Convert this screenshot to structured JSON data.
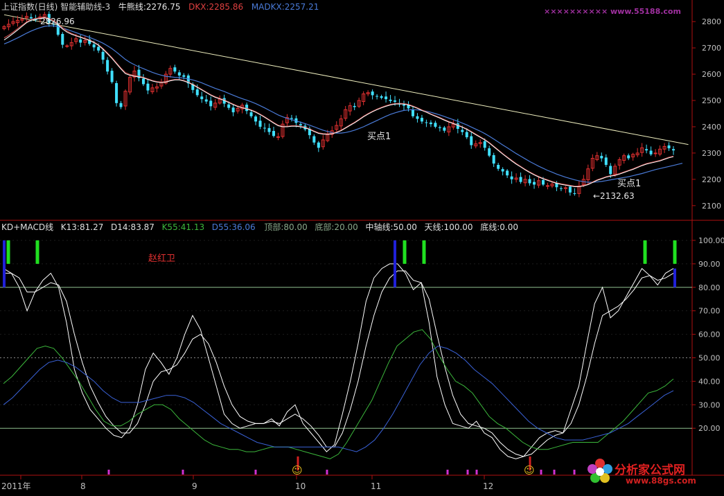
{
  "colors": {
    "bg": "#000000",
    "frame": "#b01010",
    "up": "#e03030",
    "down": "#40e0ff",
    "ma_white": "#ffffff",
    "ma_red": "#c04848",
    "ma_blue": "#4a7bd8",
    "trend": "#f0f0c0",
    "k_line": "#ffffff",
    "d_line": "#ffffff",
    "k55": "#3cb83c",
    "d55": "#3a62d8",
    "bar_green": "#20e020",
    "bar_blue": "#2020d8",
    "bar_magenta": "#d030d0",
    "grid": "#2a2a2a",
    "ref_line": "#90c090"
  },
  "header_top": {
    "title": "上证指数(日线)",
    "indicator": "智能辅助线-3",
    "bull_label": "牛熊线:2276.75",
    "dkx_label": "DKX:2285.86",
    "madkx_label": "MADKX:2257.21"
  },
  "header_bottom": {
    "name": "KD+MACD线",
    "k13": "K13:81.27",
    "d14": "D14:83.87",
    "k55": "K55:41.13",
    "d55": "D55:36.06",
    "top": "顶部:80.00",
    "bottom": "底部:20.00",
    "mid": "中轴线:50.00",
    "sky": "天线:100.00",
    "floor": "底线:0.00"
  },
  "annotations": {
    "high_label": "2826.96",
    "low_label": "←2132.63",
    "buy1_a": "买点1",
    "buy1_b": "买点1",
    "author": "赵红卫",
    "watermark_top": "×××××××××× www.55188.com",
    "watermark_bottom_cn": "分析家公式网",
    "watermark_bottom_url": "www.88gs.com",
    "smiley": "☺"
  },
  "x_axis": {
    "labels": [
      "2011年",
      "8",
      "9",
      "10",
      "11",
      "12"
    ]
  },
  "chart_data": [
    {
      "type": "candlestick",
      "title": "上证指数(日线)",
      "ylim": [
        2060,
        2840
      ],
      "yticks": [
        "2100",
        "2200",
        "2300",
        "2400",
        "2500",
        "2600",
        "2700",
        "2800"
      ],
      "close": [
        2781,
        2790,
        2800,
        2805,
        2810,
        2820,
        2812,
        2806,
        2818,
        2827,
        2796,
        2790,
        2750,
        2712,
        2708,
        2720,
        2735,
        2720,
        2728,
        2715,
        2702,
        2690,
        2655,
        2610,
        2570,
        2490,
        2475,
        2535,
        2588,
        2612,
        2585,
        2562,
        2538,
        2548,
        2552,
        2570,
        2600,
        2622,
        2610,
        2595,
        2590,
        2565,
        2540,
        2520,
        2505,
        2496,
        2478,
        2490,
        2505,
        2488,
        2472,
        2455,
        2470,
        2482,
        2460,
        2440,
        2420,
        2400,
        2395,
        2380,
        2365,
        2362,
        2410,
        2435,
        2430,
        2415,
        2405,
        2390,
        2368,
        2340,
        2320,
        2350,
        2370,
        2385,
        2405,
        2430,
        2465,
        2480,
        2475,
        2500,
        2525,
        2530,
        2520,
        2515,
        2510,
        2505,
        2498,
        2495,
        2485,
        2480,
        2470,
        2440,
        2430,
        2420,
        2415,
        2410,
        2400,
        2395,
        2385,
        2400,
        2410,
        2392,
        2380,
        2360,
        2330,
        2335,
        2340,
        2320,
        2290,
        2260,
        2240,
        2230,
        2215,
        2200,
        2205,
        2190,
        2200,
        2185,
        2180,
        2195,
        2180,
        2176,
        2182,
        2170,
        2165,
        2168,
        2150,
        2145,
        2175,
        2200,
        2240,
        2280,
        2290,
        2280,
        2255,
        2220,
        2250,
        2275,
        2290,
        2280,
        2295,
        2300,
        2320,
        2310,
        2295,
        2300,
        2315,
        2325,
        2318,
        2310
      ],
      "ma_white": [
        2730,
        2742,
        2755,
        2768,
        2782,
        2796,
        2805,
        2809,
        2812,
        2815,
        2808,
        2800,
        2788,
        2772,
        2760,
        2752,
        2746,
        2740,
        2734,
        2728,
        2720,
        2710,
        2695,
        2678,
        2660,
        2640,
        2620,
        2602,
        2596,
        2592,
        2590,
        2586,
        2580,
        2574,
        2570,
        2568,
        2570,
        2575,
        2578,
        2578,
        2574,
        2568,
        2560,
        2550,
        2540,
        2530,
        2520,
        2512,
        2506,
        2500,
        2492,
        2484,
        2477,
        2472,
        2468,
        2462,
        2455,
        2446,
        2436,
        2425,
        2414,
        2404,
        2400,
        2400,
        2402,
        2402,
        2400,
        2396,
        2390,
        2382,
        2375,
        2372,
        2371,
        2373,
        2378,
        2385,
        2395,
        2405,
        2415,
        2426,
        2438,
        2448,
        2457,
        2465,
        2472,
        2478,
        2483,
        2486,
        2487,
        2486,
        2483,
        2477,
        2470,
        2462,
        2455,
        2447,
        2440,
        2433,
        2425,
        2418,
        2412,
        2405,
        2398,
        2390,
        2380,
        2370,
        2360,
        2350,
        2338,
        2324,
        2310,
        2296,
        2283,
        2270,
        2258,
        2247,
        2236,
        2226,
        2217,
        2209,
        2202,
        2196,
        2190,
        2185,
        2181,
        2178,
        2175,
        2172,
        2172,
        2175,
        2180,
        2188,
        2196,
        2202,
        2208,
        2212,
        2215,
        2220,
        2226,
        2232,
        2238,
        2245,
        2252,
        2258,
        2262,
        2266,
        2270,
        2276,
        2282,
        2286
      ],
      "ma_red": [
        2738,
        2748,
        2760,
        2773,
        2786,
        2799,
        2808,
        2812,
        2815,
        2818,
        2812,
        2804,
        2792,
        2777,
        2764,
        2755,
        2748,
        2742,
        2736,
        2730,
        2722,
        2712,
        2698,
        2681,
        2663,
        2643,
        2623,
        2606,
        2599,
        2595,
        2592,
        2588,
        2582,
        2576,
        2572,
        2570,
        2572,
        2577,
        2580,
        2580,
        2576,
        2570,
        2562,
        2552,
        2542,
        2532,
        2522,
        2514,
        2508,
        2502,
        2494,
        2486,
        2479,
        2474,
        2470,
        2464,
        2457,
        2448,
        2438,
        2427,
        2416,
        2406,
        2402,
        2402,
        2404,
        2404,
        2402,
        2398,
        2392,
        2384,
        2377,
        2374,
        2373,
        2375,
        2380,
        2387,
        2397,
        2407,
        2417,
        2428,
        2440,
        2450,
        2459,
        2467,
        2474,
        2480,
        2485,
        2488,
        2489,
        2488,
        2485,
        2479,
        2472,
        2464,
        2457,
        2449,
        2442,
        2435,
        2427,
        2420,
        2414,
        2407,
        2400,
        2392,
        2382,
        2372,
        2362,
        2352,
        2340,
        2326,
        2312,
        2298,
        2285,
        2272,
        2260,
        2249,
        2238,
        2228,
        2219,
        2211,
        2204,
        2198,
        2192,
        2187,
        2183,
        2180,
        2177,
        2174,
        2174,
        2177,
        2182,
        2190,
        2198,
        2204,
        2210,
        2214,
        2217,
        2222,
        2228,
        2234,
        2240,
        2247,
        2254,
        2260,
        2264,
        2268,
        2272,
        2278,
        2284,
        2288
      ],
      "ma_blue": [
        2715,
        2722,
        2730,
        2738,
        2747,
        2756,
        2764,
        2771,
        2777,
        2782,
        2784,
        2784,
        2781,
        2776,
        2770,
        2764,
        2758,
        2752,
        2746,
        2740,
        2733,
        2726,
        2718,
        2708,
        2697,
        2684,
        2670,
        2656,
        2645,
        2636,
        2628,
        2621,
        2614,
        2607,
        2601,
        2596,
        2592,
        2590,
        2588,
        2587,
        2585,
        2582,
        2578,
        2573,
        2567,
        2560,
        2553,
        2546,
        2540,
        2534,
        2527,
        2520,
        2513,
        2507,
        2501,
        2495,
        2488,
        2480,
        2472,
        2463,
        2454,
        2445,
        2438,
        2432,
        2427,
        2422,
        2417,
        2412,
        2406,
        2400,
        2393,
        2387,
        2382,
        2378,
        2376,
        2376,
        2378,
        2382,
        2387,
        2393,
        2400,
        2408,
        2416,
        2424,
        2432,
        2440,
        2447,
        2453,
        2458,
        2462,
        2464,
        2465,
        2464,
        2462,
        2459,
        2455,
        2450,
        2445,
        2439,
        2433,
        2427,
        2421,
        2414,
        2407,
        2399,
        2391,
        2383,
        2374,
        2364,
        2353,
        2342,
        2331,
        2320,
        2309,
        2298,
        2288,
        2278,
        2268,
        2259,
        2250,
        2242,
        2234,
        2227,
        2220,
        2214,
        2208,
        2203,
        2198,
        2194,
        2191,
        2189,
        2189,
        2190,
        2192,
        2195,
        2198,
        2201,
        2204,
        2207,
        2210,
        2214,
        2218,
        2222,
        2227,
        2232,
        2237,
        2241,
        2245,
        2249,
        2253,
        2257,
        2261
      ],
      "trendline": [
        [
          0,
          2826
        ],
        [
          148,
          2322
        ]
      ]
    },
    {
      "type": "line",
      "title": "KD+MACD线",
      "ylim": [
        0,
        105
      ],
      "yticks": [
        "20.00",
        "30.00",
        "40.00",
        "50.00",
        "60.00",
        "70.00",
        "80.00",
        "90.00",
        "100.00"
      ],
      "ref_lines": [
        20,
        50,
        80
      ],
      "series": [
        {
          "name": "K13",
          "values": [
            88,
            86,
            80,
            70,
            78,
            83,
            86,
            80,
            65,
            45,
            35,
            28,
            24,
            20,
            17,
            16,
            20,
            30,
            45,
            52,
            48,
            43,
            50,
            60,
            68,
            62,
            50,
            38,
            26,
            22,
            20,
            21,
            22,
            22,
            24,
            21,
            27,
            30,
            22,
            18,
            14,
            10,
            13,
            26,
            40,
            56,
            74,
            84,
            88,
            90,
            90,
            86,
            79,
            82,
            65,
            42,
            30,
            22,
            21,
            20,
            23,
            18,
            16,
            11,
            8,
            7,
            8,
            12,
            16,
            18,
            19,
            18,
            28,
            38,
            56,
            73,
            80,
            67,
            70,
            76,
            82,
            88,
            85,
            81,
            86,
            88
          ]
        },
        {
          "name": "D14",
          "values": [
            86,
            86,
            84,
            78,
            78,
            80,
            82,
            81,
            74,
            60,
            48,
            38,
            31,
            25,
            21,
            18,
            18,
            22,
            30,
            40,
            44,
            45,
            47,
            52,
            58,
            60,
            56,
            48,
            38,
            30,
            25,
            23,
            22,
            22,
            23,
            22,
            24,
            26,
            24,
            21,
            17,
            12,
            12,
            18,
            28,
            40,
            55,
            68,
            78,
            84,
            87,
            87,
            83,
            82,
            75,
            60,
            46,
            34,
            26,
            22,
            21,
            20,
            18,
            14,
            11,
            9,
            8,
            9,
            12,
            15,
            17,
            18,
            22,
            30,
            42,
            56,
            68,
            70,
            72,
            75,
            79,
            84,
            85,
            83,
            84,
            86
          ]
        },
        {
          "name": "K55",
          "values": [
            39,
            42,
            46,
            50,
            54,
            55,
            54,
            50,
            45,
            40,
            34,
            28,
            23,
            21,
            21,
            23,
            26,
            28,
            30,
            30,
            28,
            24,
            21,
            18,
            15,
            13,
            12,
            11,
            11,
            10,
            10,
            11,
            12,
            12,
            12,
            11,
            10,
            9,
            8,
            7,
            9,
            14,
            20,
            26,
            32,
            40,
            48,
            55,
            58,
            61,
            62,
            58,
            51,
            45,
            40,
            38,
            35,
            30,
            25,
            22,
            20,
            17,
            14,
            12,
            11,
            11,
            12,
            13,
            14,
            14,
            14,
            14,
            17,
            20,
            23,
            27,
            31,
            35,
            36,
            38,
            41
          ]
        },
        {
          "name": "D55",
          "values": [
            30,
            33,
            37,
            41,
            45,
            48,
            49,
            48,
            46,
            43,
            40,
            36,
            33,
            31,
            31,
            31,
            32,
            33,
            34,
            34,
            33,
            31,
            28,
            25,
            22,
            20,
            18,
            16,
            14,
            13,
            12,
            12,
            12,
            12,
            12,
            12,
            12,
            12,
            11,
            10,
            12,
            15,
            20,
            26,
            33,
            40,
            47,
            52,
            55,
            54,
            52,
            49,
            45,
            42,
            39,
            35,
            31,
            27,
            23,
            20,
            18,
            16,
            15,
            15,
            15,
            16,
            17,
            18,
            20,
            22,
            25,
            28,
            31,
            34,
            36
          ]
        }
      ]
    }
  ]
}
